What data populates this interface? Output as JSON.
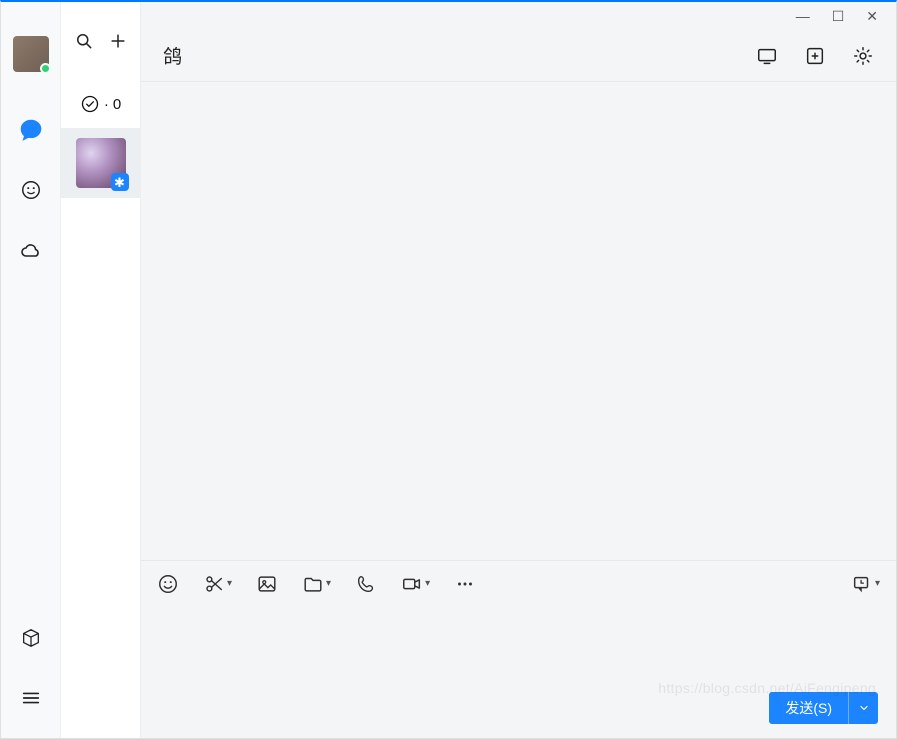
{
  "window": {
    "minimize": "—",
    "maximize": "☐",
    "close": "✕"
  },
  "rail": {
    "items": [
      "chat",
      "emoji",
      "cloud"
    ],
    "bottom": [
      "box",
      "menu"
    ]
  },
  "list": {
    "status_count": "0",
    "status_sep": "·"
  },
  "chat": {
    "title": "鸽",
    "header_icons": [
      "screen",
      "add-panel",
      "settings"
    ],
    "toolbar_icons": [
      "emoji",
      "scissors",
      "image",
      "folder",
      "phone",
      "video",
      "more"
    ],
    "history_icon": "history",
    "send_label": "发送(S)"
  },
  "watermark": "https://blog.csdn.net/AiFengipeng"
}
